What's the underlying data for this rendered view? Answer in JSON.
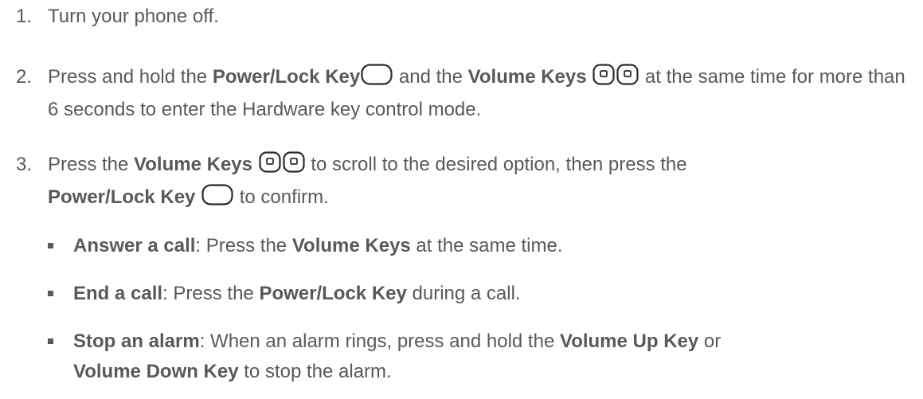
{
  "steps": [
    {
      "number": "1.",
      "text": "Turn your phone off."
    },
    {
      "number": "2.",
      "pre": "Press and hold the ",
      "bold1": "Power/Lock Key",
      "mid": " and the ",
      "bold2": "Volume Keys",
      "post": " at the same time for more than 6 seconds to enter the Hardware key control mode."
    },
    {
      "number": "3.",
      "pre": "Press the ",
      "bold1": "Volume Keys",
      "mid": " to scroll to the desired option, then press the ",
      "bold2": "Power/Lock Key",
      "post": " to confirm."
    }
  ],
  "bullets": [
    {
      "title": "Answer a call",
      "pre": ": Press the ",
      "bold1": "Volume Keys",
      "post": " at the same time."
    },
    {
      "title": "End a call",
      "pre": ": Press the ",
      "bold1": "Power/Lock Key",
      "post": " during a call."
    },
    {
      "title": "Stop an alarm",
      "pre": ": When an alarm rings, press and hold the ",
      "bold1": "Volume Up Key",
      "mid": " or ",
      "bold2": "Volume Down Key",
      "post": " to stop the alarm."
    }
  ],
  "icons": {
    "power_key": "power-lock-key-icon",
    "volume_key": "volume-key-icon"
  },
  "colors": {
    "text": "#595959"
  }
}
